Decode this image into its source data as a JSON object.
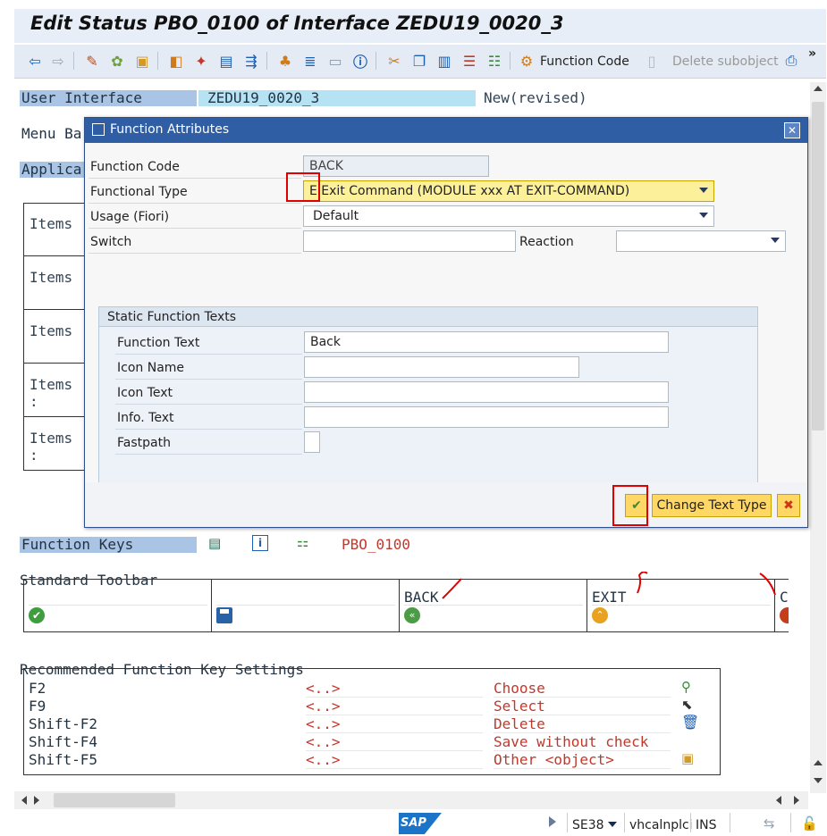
{
  "window": {
    "title": "Edit Status PBO_0100 of Interface ZEDU19_0020_3"
  },
  "toolbar": {
    "function_code_label": "Function Code",
    "delete_subobject_label": "Delete subobject",
    "more_label": "»"
  },
  "header": {
    "user_interface_label": "User Interface",
    "user_interface_value": "ZEDU19_0020_3",
    "status_text": "New(revised)",
    "menu_bar_label": "Menu Ba",
    "application_label": "Applica"
  },
  "items_rows": [
    {
      "label": "Items"
    },
    {
      "label": "Items"
    },
    {
      "label": "Items"
    },
    {
      "label": "Items :"
    },
    {
      "label": "Items :"
    }
  ],
  "dialog": {
    "title": "Function Attributes",
    "fields": {
      "function_code_label": "Function Code",
      "function_code_value": "BACK",
      "functional_type_label": "Functional Type",
      "functional_type_value": "E Exit Command (MODULE xxx AT EXIT-COMMAND)",
      "usage_label": "Usage (Fiori)",
      "usage_value": "Default",
      "switch_label": "Switch",
      "switch_value": "",
      "reaction_label": "Reaction",
      "reaction_value": ""
    },
    "static_texts": {
      "group_title": "Static Function Texts",
      "function_text_label": "Function Text",
      "function_text_value": "Back",
      "icon_name_label": "Icon Name",
      "icon_name_value": "",
      "icon_text_label": "Icon Text",
      "icon_text_value": "",
      "info_text_label": "Info. Text",
      "info_text_value": "",
      "fastpath_label": "Fastpath",
      "fastpath_value": ""
    },
    "buttons": {
      "change_text_type": "Change Text Type"
    }
  },
  "function_keys": {
    "label": "Function Keys",
    "status_name": "PBO_0100"
  },
  "standard_toolbar": {
    "label": "Standard Toolbar",
    "cells": [
      {
        "text": "",
        "icon": "check-icon"
      },
      {
        "text": "",
        "icon": "save-icon"
      },
      {
        "text": "BACK",
        "icon": "back-icon"
      },
      {
        "text": "EXIT",
        "icon": "exit-icon"
      },
      {
        "text": "C",
        "icon": "cancel-icon"
      }
    ]
  },
  "recommended": {
    "label": "Recommended Function Key Settings",
    "rows": [
      {
        "key": "F2",
        "code": "<..>",
        "text": "Choose",
        "icon": "choose-icon"
      },
      {
        "key": "F9",
        "code": "<..>",
        "text": "Select",
        "icon": "select-icon"
      },
      {
        "key": "Shift-F2",
        "code": "<..>",
        "text": "Delete",
        "icon": "trash-icon"
      },
      {
        "key": "Shift-F4",
        "code": "<..>",
        "text": "Save without check",
        "icon": ""
      },
      {
        "key": "Shift-F5",
        "code": "<..>",
        "text": "Other <object>",
        "icon": "other-object-icon"
      }
    ]
  },
  "statusbar": {
    "sap_logo": "SAP",
    "transaction": "SE38",
    "server": "vhcalnplci",
    "mode": "INS"
  },
  "colors": {
    "accent_blue": "#2f5ea5",
    "button_yellow": "#ffd764",
    "highlight_red": "#e00000",
    "label_blue": "#a9c4e4"
  }
}
